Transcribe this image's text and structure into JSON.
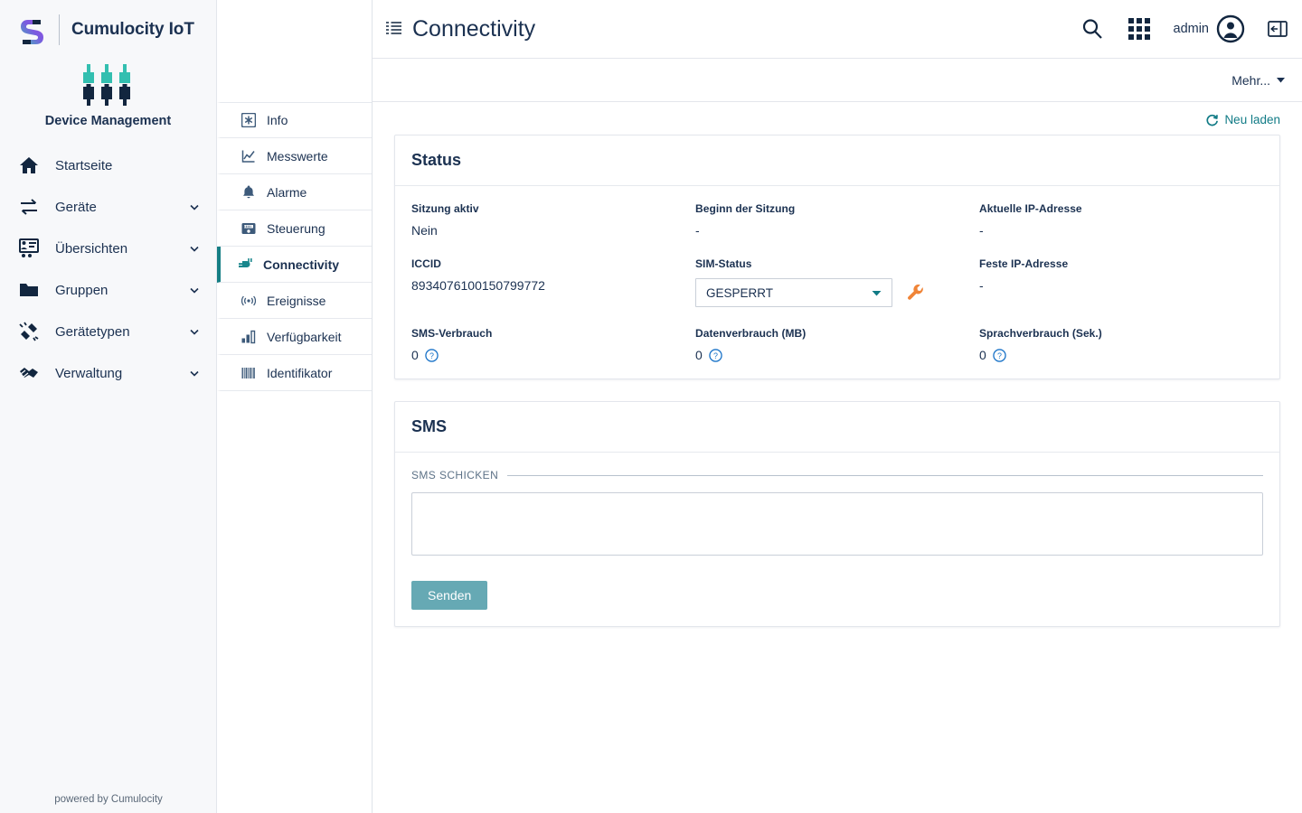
{
  "brand": {
    "name": "Cumulocity IoT",
    "logo_icon": "cumulocity-s-logo",
    "app_name": "Device Management",
    "app_icon": "device-plugs-icon"
  },
  "sidebar": {
    "items": [
      {
        "label": "Startseite",
        "icon": "home-icon",
        "expandable": false
      },
      {
        "label": "Geräte",
        "icon": "transfer-arrows-icon",
        "expandable": true
      },
      {
        "label": "Übersichten",
        "icon": "presentation-icon",
        "expandable": true
      },
      {
        "label": "Gruppen",
        "icon": "folder-icon",
        "expandable": true
      },
      {
        "label": "Gerätetypen",
        "icon": "plug-connect-icon",
        "expandable": true
      },
      {
        "label": "Verwaltung",
        "icon": "handshake-icon",
        "expandable": true
      }
    ],
    "footer": "powered by Cumulocity"
  },
  "topbar": {
    "menu_icon": "hamburger-menu-icon",
    "title": "Connectivity",
    "search_icon": "search-icon",
    "apps_icon": "app-switcher-grid-icon",
    "user_label": "admin",
    "user_icon": "user-avatar-icon",
    "right_drawer_icon": "right-panel-toggle-icon"
  },
  "subbar": {
    "more_label": "Mehr...",
    "more_icon": "caret-down-icon"
  },
  "tabs": [
    {
      "label": "Info",
      "icon": "asterisk-icon",
      "active": false
    },
    {
      "label": "Messwerte",
      "icon": "line-chart-icon",
      "active": false
    },
    {
      "label": "Alarme",
      "icon": "bell-icon",
      "active": false
    },
    {
      "label": "Steuerung",
      "icon": "control-device-icon",
      "active": false
    },
    {
      "label": "Connectivity",
      "icon": "plug-icon",
      "active": true
    },
    {
      "label": "Ereignisse",
      "icon": "signal-waves-icon",
      "active": false
    },
    {
      "label": "Verfügbarkeit",
      "icon": "bar-chart-icon",
      "active": false
    },
    {
      "label": "Identifikator",
      "icon": "barcode-icon",
      "active": false
    }
  ],
  "content": {
    "reload": {
      "label": "Neu laden",
      "icon": "refresh-icon"
    },
    "status_card": {
      "title": "Status",
      "fields": [
        {
          "label": "Sitzung aktiv",
          "value": "Nein",
          "type": "text"
        },
        {
          "label": "Beginn der Sitzung",
          "value": "-",
          "type": "text"
        },
        {
          "label": "Aktuelle IP-Adresse",
          "value": "-",
          "type": "text"
        },
        {
          "label": "ICCID",
          "value": "8934076100150799772",
          "type": "text"
        },
        {
          "label": "SIM-Status",
          "value": "GESPERRT",
          "type": "select",
          "tool_icon": "wrench-icon"
        },
        {
          "label": "Feste IP-Adresse",
          "value": "-",
          "type": "text"
        },
        {
          "label": "SMS-Verbrauch",
          "value": "0",
          "type": "text-help",
          "help_icon": "help-circle-icon"
        },
        {
          "label": "Datenverbrauch (MB)",
          "value": "0",
          "type": "text-help",
          "help_icon": "help-circle-icon"
        },
        {
          "label": "Sprachverbrauch (Sek.)",
          "value": "0",
          "type": "text-help",
          "help_icon": "help-circle-icon"
        }
      ],
      "sim_status_options": [
        "GESPERRT"
      ]
    },
    "sms_card": {
      "title": "SMS",
      "legend": "SMS SCHICKEN",
      "textarea_value": "",
      "textarea_placeholder": "",
      "send_label": "Senden"
    }
  },
  "colors": {
    "brand_dark": "#1b3151",
    "teal_accent": "#157e84",
    "link_teal": "#117b86",
    "orange_tool": "#f08437",
    "help_blue": "#1a73c8",
    "send_button": "#66a9b4",
    "sidebar_bg": "#f7f8fa"
  }
}
